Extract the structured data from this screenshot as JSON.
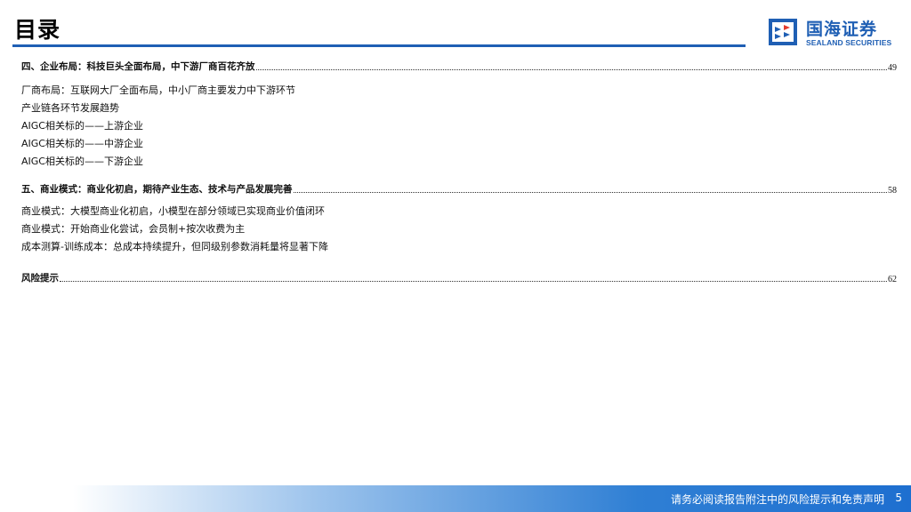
{
  "header": {
    "title": "目录",
    "logo_cn": "国海证券",
    "logo_en": "SEALAND SECURITIES",
    "accent_color": "#1f5fb4"
  },
  "toc": [
    {
      "heading": "四、企业布局：科技巨头全面布局，中下游厂商百花齐放",
      "page": "49",
      "items": [
        "厂商布局：互联网大厂全面布局，中小厂商主要发力中下游环节",
        "产业链各环节发展趋势",
        "AIGC相关标的——上游企业",
        "AIGC相关标的——中游企业",
        "AIGC相关标的——下游企业"
      ]
    },
    {
      "heading": "五、商业模式：商业化初启，期待产业生态、技术与产品发展完善",
      "page": "58",
      "items": [
        "商业模式：大模型商业化初启，小模型在部分领域已实现商业价值闭环",
        "商业模式：开始商业化尝试，会员制+按次收费为主",
        "成本测算-训练成本：总成本持续提升，但同级别参数消耗量将显著下降"
      ]
    },
    {
      "heading": "风险提示",
      "page": "62",
      "items": []
    }
  ],
  "footer": {
    "disclaimer": "请务必阅读报告附注中的风险提示和免责声明",
    "page_number": "5"
  }
}
